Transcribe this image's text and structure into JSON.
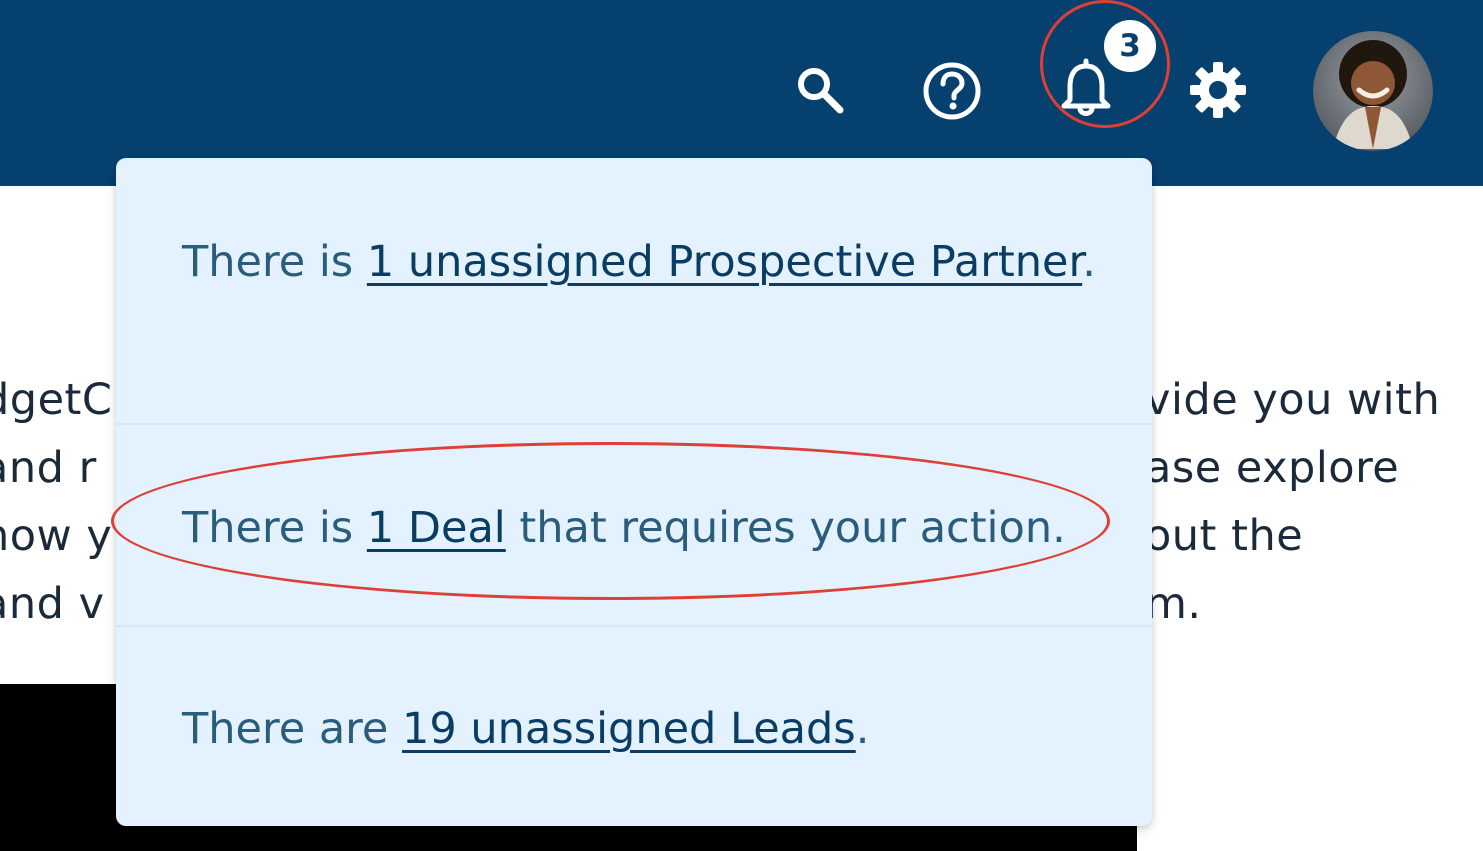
{
  "header": {
    "icons": {
      "search": "search-icon",
      "help": "help-icon",
      "notifications": "bell-icon",
      "settings": "gear-icon",
      "avatar": "user-avatar"
    },
    "notification_count": "3",
    "background_color": "#06406f"
  },
  "background_text": {
    "left_lines": [
      "dgetC",
      " and r",
      "now y",
      " and v"
    ],
    "right_lines": [
      "vide you with",
      "ase explore",
      " out the",
      "m."
    ]
  },
  "notifications": {
    "background_color": "#e3f2fe",
    "items": [
      {
        "prefix": "There is ",
        "link": "1 unassigned Prospective Partner",
        "suffix": "."
      },
      {
        "prefix": "There is ",
        "link": "1 Deal",
        "suffix": " that requires your action."
      },
      {
        "prefix": "There are ",
        "link": "19 unassigned Leads",
        "suffix": "."
      }
    ]
  },
  "annotation_color": "#df3f34"
}
